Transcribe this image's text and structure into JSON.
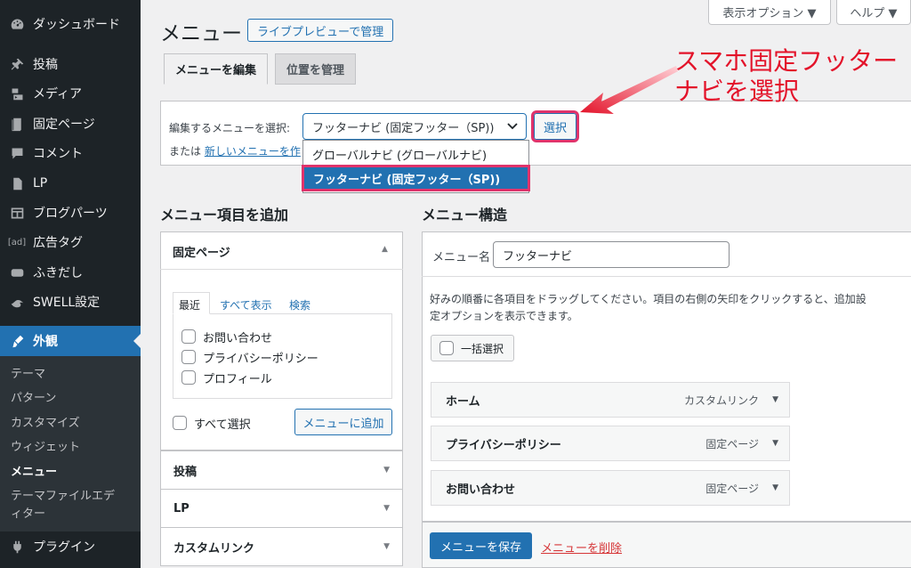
{
  "sidebar": {
    "items": [
      {
        "label": "ダッシュボード",
        "icon": "dashboard-icon"
      },
      {
        "label": "投稿",
        "icon": "pin-icon"
      },
      {
        "label": "メディア",
        "icon": "media-icon"
      },
      {
        "label": "固定ページ",
        "icon": "page-icon"
      },
      {
        "label": "コメント",
        "icon": "comment-icon"
      },
      {
        "label": "LP",
        "icon": "document-icon"
      },
      {
        "label": "ブログパーツ",
        "icon": "table-icon"
      },
      {
        "label": "広告タグ",
        "icon": "ad-icon",
        "icon_text": "[ad]"
      },
      {
        "label": "ふきだし",
        "icon": "speech-bubble-icon"
      },
      {
        "label": "SWELL設定",
        "icon": "swell-icon"
      },
      {
        "label": "外観",
        "icon": "brush-icon"
      },
      {
        "label": "プラグイン",
        "icon": "plugin-icon"
      }
    ],
    "submenu": [
      "テーマ",
      "パターン",
      "カスタマイズ",
      "ウィジェット",
      "メニュー",
      "テーマファイルエディター"
    ]
  },
  "header": {
    "screen_options": "表示オプション ▼",
    "help": "ヘルプ ▼",
    "title": "メニュー",
    "live_preview": "ライブプレビューで管理"
  },
  "tabs": {
    "edit": "メニューを編集",
    "locations": "位置を管理"
  },
  "select_menu": {
    "label": "編集するメニューを選択:",
    "current": "フッターナビ (固定フッター（SP))",
    "button": "選択",
    "or_prefix": "または",
    "or_link": "新しいメニューを作",
    "options": [
      "グローバルナビ (グローバルナビ)",
      "フッターナビ (固定フッター（SP))"
    ]
  },
  "annotation": {
    "line1": "スマホ固定フッター",
    "line2": "ナビを選択",
    "color": "#e3132a"
  },
  "add_items": {
    "title": "メニュー項目を追加",
    "pages_header": "固定ページ",
    "inner_tabs": [
      "最近",
      "すべて表示",
      "検索"
    ],
    "pages": [
      "お問い合わせ",
      "プライバシーポリシー",
      "プロフィール"
    ],
    "select_all": "すべて選択",
    "add_button": "メニューに追加",
    "sections": [
      "投稿",
      "LP",
      "カスタムリンク"
    ]
  },
  "structure": {
    "title": "メニュー構造",
    "name_label": "メニュー名",
    "name_value": "フッターナビ",
    "instructions": [
      "好みの順番に各項目をドラッグしてください。項目の右側の矢印をクリックすると、追加設",
      "定オプションを表示できます。"
    ],
    "bulk_select": "一括選択",
    "items": [
      {
        "title": "ホーム",
        "type": "カスタムリンク"
      },
      {
        "title": "プライバシーポリシー",
        "type": "固定ページ"
      },
      {
        "title": "お問い合わせ",
        "type": "固定ページ"
      }
    ],
    "save": "メニューを保存",
    "delete": "メニューを削除"
  },
  "colors": {
    "accent": "#2271b1",
    "sidebar": "#1d2327",
    "highlight": "#e0336b"
  }
}
